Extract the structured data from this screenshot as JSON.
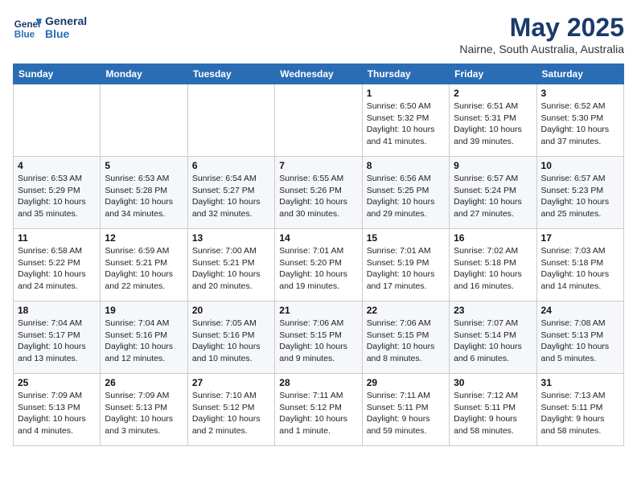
{
  "header": {
    "logo_line1": "General",
    "logo_line2": "Blue",
    "month_title": "May 2025",
    "location": "Nairne, South Australia, Australia"
  },
  "weekdays": [
    "Sunday",
    "Monday",
    "Tuesday",
    "Wednesday",
    "Thursday",
    "Friday",
    "Saturday"
  ],
  "weeks": [
    [
      {
        "day": "",
        "info": ""
      },
      {
        "day": "",
        "info": ""
      },
      {
        "day": "",
        "info": ""
      },
      {
        "day": "",
        "info": ""
      },
      {
        "day": "1",
        "info": "Sunrise: 6:50 AM\nSunset: 5:32 PM\nDaylight: 10 hours\nand 41 minutes."
      },
      {
        "day": "2",
        "info": "Sunrise: 6:51 AM\nSunset: 5:31 PM\nDaylight: 10 hours\nand 39 minutes."
      },
      {
        "day": "3",
        "info": "Sunrise: 6:52 AM\nSunset: 5:30 PM\nDaylight: 10 hours\nand 37 minutes."
      }
    ],
    [
      {
        "day": "4",
        "info": "Sunrise: 6:53 AM\nSunset: 5:29 PM\nDaylight: 10 hours\nand 35 minutes."
      },
      {
        "day": "5",
        "info": "Sunrise: 6:53 AM\nSunset: 5:28 PM\nDaylight: 10 hours\nand 34 minutes."
      },
      {
        "day": "6",
        "info": "Sunrise: 6:54 AM\nSunset: 5:27 PM\nDaylight: 10 hours\nand 32 minutes."
      },
      {
        "day": "7",
        "info": "Sunrise: 6:55 AM\nSunset: 5:26 PM\nDaylight: 10 hours\nand 30 minutes."
      },
      {
        "day": "8",
        "info": "Sunrise: 6:56 AM\nSunset: 5:25 PM\nDaylight: 10 hours\nand 29 minutes."
      },
      {
        "day": "9",
        "info": "Sunrise: 6:57 AM\nSunset: 5:24 PM\nDaylight: 10 hours\nand 27 minutes."
      },
      {
        "day": "10",
        "info": "Sunrise: 6:57 AM\nSunset: 5:23 PM\nDaylight: 10 hours\nand 25 minutes."
      }
    ],
    [
      {
        "day": "11",
        "info": "Sunrise: 6:58 AM\nSunset: 5:22 PM\nDaylight: 10 hours\nand 24 minutes."
      },
      {
        "day": "12",
        "info": "Sunrise: 6:59 AM\nSunset: 5:21 PM\nDaylight: 10 hours\nand 22 minutes."
      },
      {
        "day": "13",
        "info": "Sunrise: 7:00 AM\nSunset: 5:21 PM\nDaylight: 10 hours\nand 20 minutes."
      },
      {
        "day": "14",
        "info": "Sunrise: 7:01 AM\nSunset: 5:20 PM\nDaylight: 10 hours\nand 19 minutes."
      },
      {
        "day": "15",
        "info": "Sunrise: 7:01 AM\nSunset: 5:19 PM\nDaylight: 10 hours\nand 17 minutes."
      },
      {
        "day": "16",
        "info": "Sunrise: 7:02 AM\nSunset: 5:18 PM\nDaylight: 10 hours\nand 16 minutes."
      },
      {
        "day": "17",
        "info": "Sunrise: 7:03 AM\nSunset: 5:18 PM\nDaylight: 10 hours\nand 14 minutes."
      }
    ],
    [
      {
        "day": "18",
        "info": "Sunrise: 7:04 AM\nSunset: 5:17 PM\nDaylight: 10 hours\nand 13 minutes."
      },
      {
        "day": "19",
        "info": "Sunrise: 7:04 AM\nSunset: 5:16 PM\nDaylight: 10 hours\nand 12 minutes."
      },
      {
        "day": "20",
        "info": "Sunrise: 7:05 AM\nSunset: 5:16 PM\nDaylight: 10 hours\nand 10 minutes."
      },
      {
        "day": "21",
        "info": "Sunrise: 7:06 AM\nSunset: 5:15 PM\nDaylight: 10 hours\nand 9 minutes."
      },
      {
        "day": "22",
        "info": "Sunrise: 7:06 AM\nSunset: 5:15 PM\nDaylight: 10 hours\nand 8 minutes."
      },
      {
        "day": "23",
        "info": "Sunrise: 7:07 AM\nSunset: 5:14 PM\nDaylight: 10 hours\nand 6 minutes."
      },
      {
        "day": "24",
        "info": "Sunrise: 7:08 AM\nSunset: 5:13 PM\nDaylight: 10 hours\nand 5 minutes."
      }
    ],
    [
      {
        "day": "25",
        "info": "Sunrise: 7:09 AM\nSunset: 5:13 PM\nDaylight: 10 hours\nand 4 minutes."
      },
      {
        "day": "26",
        "info": "Sunrise: 7:09 AM\nSunset: 5:13 PM\nDaylight: 10 hours\nand 3 minutes."
      },
      {
        "day": "27",
        "info": "Sunrise: 7:10 AM\nSunset: 5:12 PM\nDaylight: 10 hours\nand 2 minutes."
      },
      {
        "day": "28",
        "info": "Sunrise: 7:11 AM\nSunset: 5:12 PM\nDaylight: 10 hours\nand 1 minute."
      },
      {
        "day": "29",
        "info": "Sunrise: 7:11 AM\nSunset: 5:11 PM\nDaylight: 9 hours\nand 59 minutes."
      },
      {
        "day": "30",
        "info": "Sunrise: 7:12 AM\nSunset: 5:11 PM\nDaylight: 9 hours\nand 58 minutes."
      },
      {
        "day": "31",
        "info": "Sunrise: 7:13 AM\nSunset: 5:11 PM\nDaylight: 9 hours\nand 58 minutes."
      }
    ]
  ]
}
